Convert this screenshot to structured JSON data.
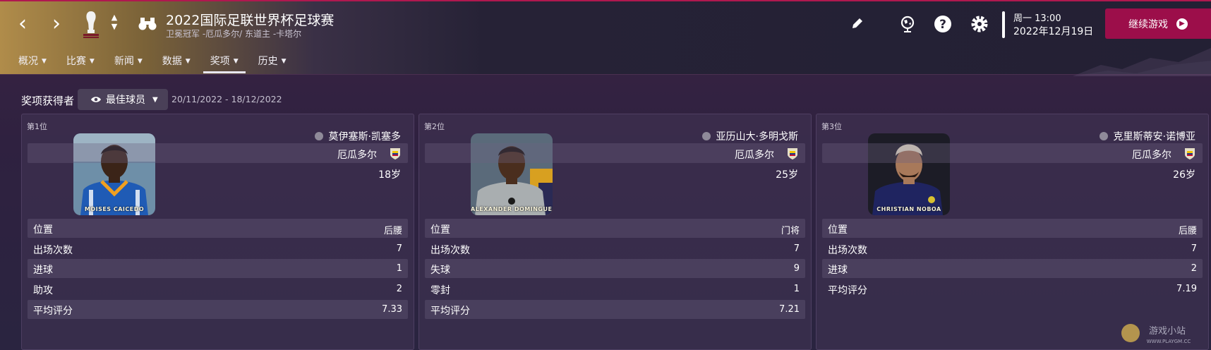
{
  "header": {
    "competition_title": "2022国际足联世界杯足球赛",
    "competition_subtitle": "卫冕冠军 -厄瓜多尔/ 东道主 -卡塔尔",
    "clock_day": "周一 13:00",
    "clock_date": "2022年12月19日",
    "continue_label": "继续游戏",
    "accent_color": "#9c0e4a",
    "menu": [
      {
        "label": "概况",
        "active": false
      },
      {
        "label": "比赛",
        "active": false
      },
      {
        "label": "新闻",
        "active": false
      },
      {
        "label": "数据",
        "active": false
      },
      {
        "label": "奖项",
        "active": true
      },
      {
        "label": "历史",
        "active": false
      }
    ],
    "icons": [
      "back-arrow-icon",
      "forward-arrow-icon",
      "world-cup-trophy-icon",
      "up-down-icon",
      "binoculars-icon",
      "pencil-icon",
      "globe-icon",
      "help-icon",
      "settings-icon"
    ]
  },
  "filter": {
    "label": "奖项获得者",
    "selected": "最佳球员",
    "date_range": "20/11/2022 - 18/12/2022"
  },
  "cards": [
    {
      "rank": "第1位",
      "player_name": "莫伊塞斯·凯塞多",
      "photo_caption": "MOISES CAICEDO",
      "nation": "厄瓜多尔",
      "age": "18岁",
      "stats": [
        {
          "label": "位置",
          "value": "后腰"
        },
        {
          "label": "出场次数",
          "value": "7"
        },
        {
          "label": "进球",
          "value": "1"
        },
        {
          "label": "助攻",
          "value": "2"
        },
        {
          "label": "平均评分",
          "value": "7.33"
        }
      ]
    },
    {
      "rank": "第2位",
      "player_name": "亚历山大·多明戈斯",
      "photo_caption": "ALEXANDER DOMINGUEZ",
      "nation": "厄瓜多尔",
      "age": "25岁",
      "stats": [
        {
          "label": "位置",
          "value": "门将"
        },
        {
          "label": "出场次数",
          "value": "7"
        },
        {
          "label": "失球",
          "value": "9"
        },
        {
          "label": "零封",
          "value": "1"
        },
        {
          "label": "平均评分",
          "value": "7.21"
        }
      ]
    },
    {
      "rank": "第3位",
      "player_name": "克里斯蒂安·诺博亚",
      "photo_caption": "CHRISTIAN NOBOA",
      "nation": "厄瓜多尔",
      "age": "26岁",
      "stats": [
        {
          "label": "位置",
          "value": "后腰"
        },
        {
          "label": "出场次数",
          "value": "7"
        },
        {
          "label": "进球",
          "value": "2"
        },
        {
          "label": "平均评分",
          "value": "7.19"
        }
      ]
    }
  ],
  "watermark": {
    "text": "游戏小站",
    "url_text": "WWW.PLAYGM.CC"
  }
}
